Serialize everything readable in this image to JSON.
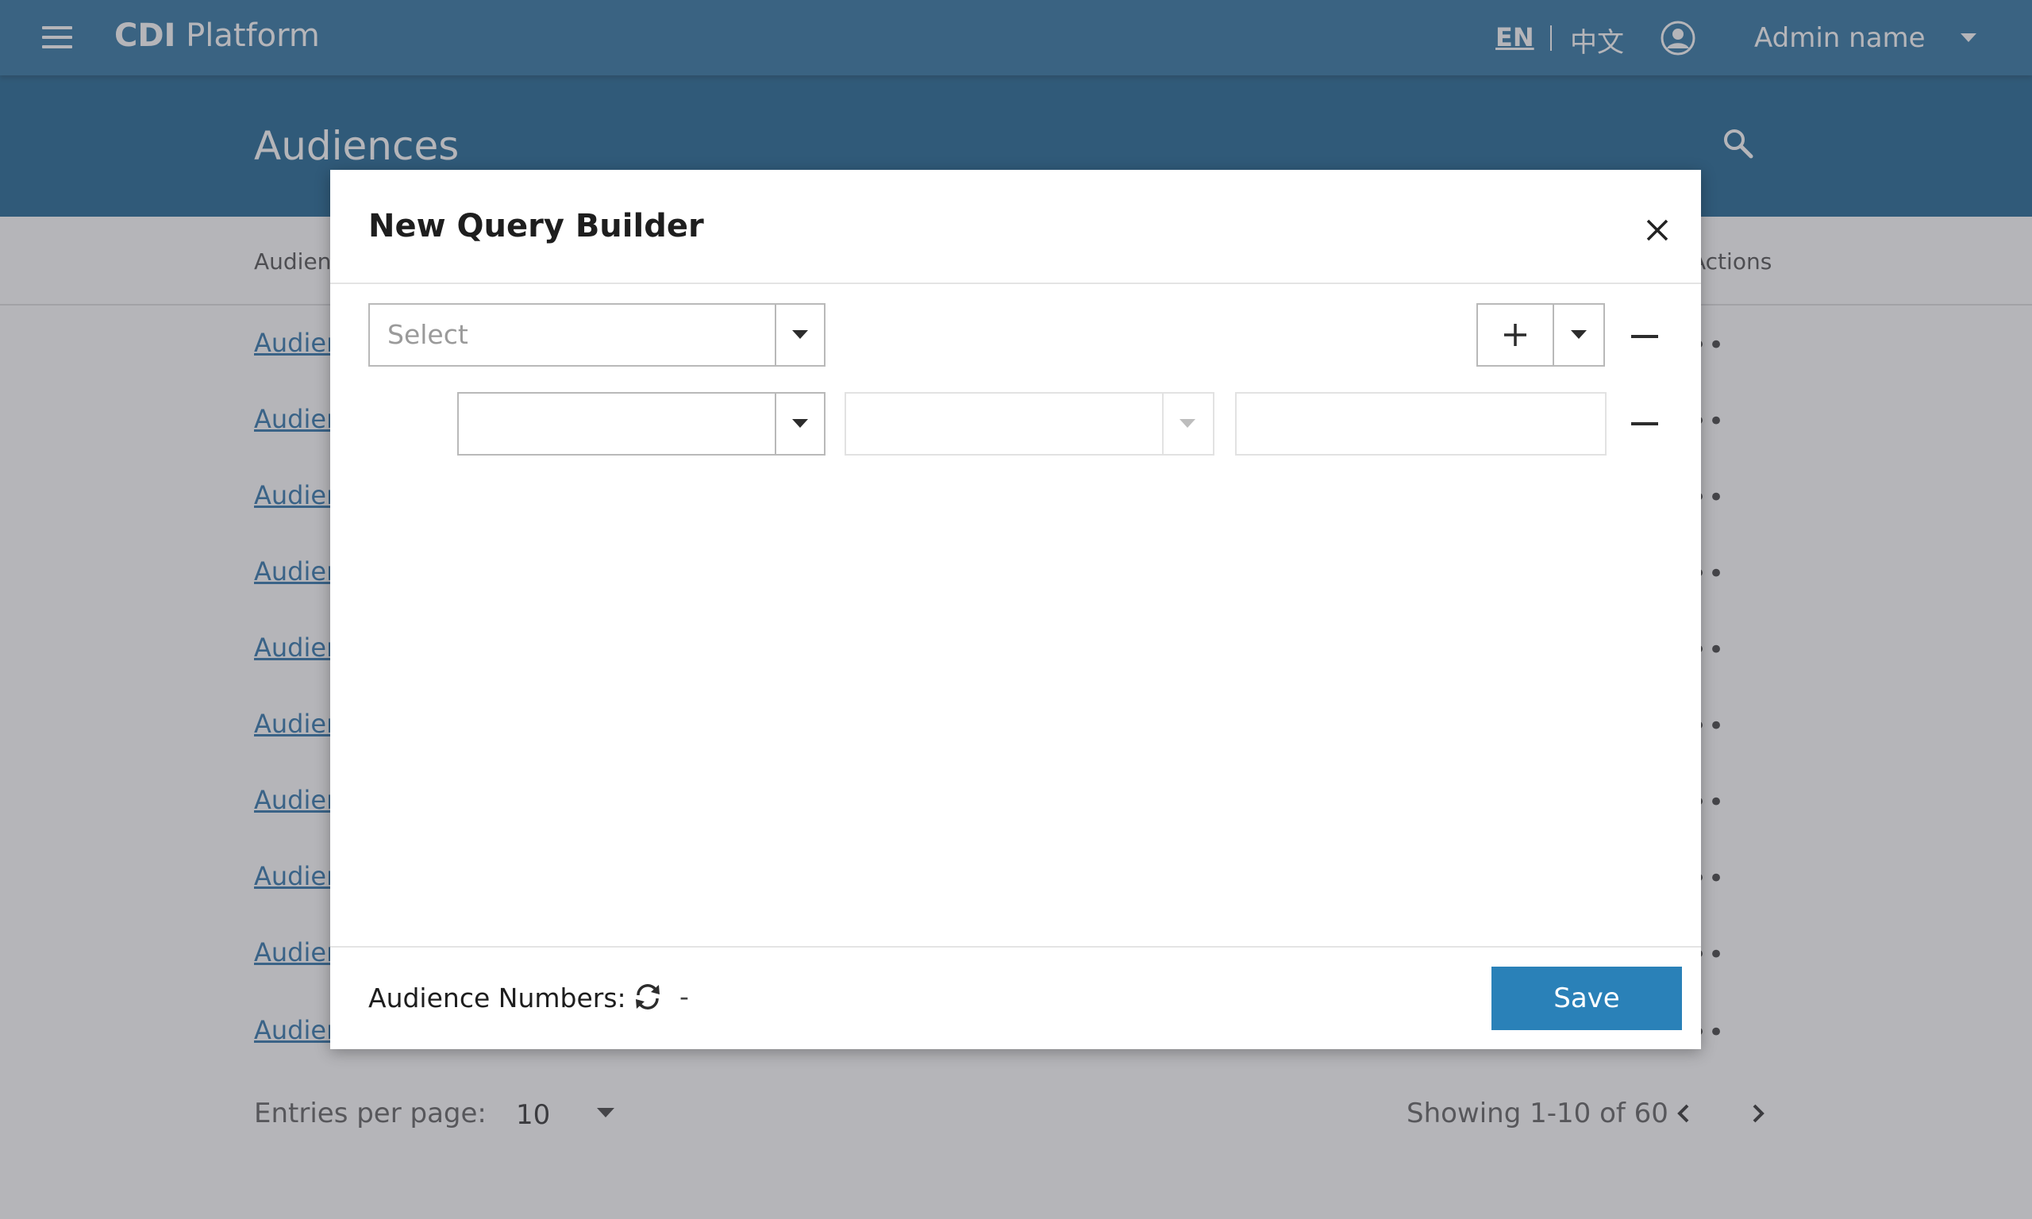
{
  "topbar": {
    "app_name_bold": "CDI",
    "app_name_rest": " Platform",
    "lang_en": "EN",
    "lang_zh": "中文",
    "admin_name": "Admin name"
  },
  "page": {
    "title": "Audiences"
  },
  "table": {
    "column_audience": "Audien",
    "column_actions": "Actions",
    "rows": [
      {
        "name": "Audien",
        "actions": "••"
      },
      {
        "name": "Audien",
        "actions": "••"
      },
      {
        "name": "Audien",
        "actions": "••"
      },
      {
        "name": "Audien",
        "actions": "••"
      },
      {
        "name": "Audien",
        "actions": "••"
      },
      {
        "name": "Audien",
        "actions": "••"
      },
      {
        "name": "Audien",
        "actions": "••"
      },
      {
        "name": "Audien",
        "actions": "••"
      },
      {
        "name": "Audien",
        "actions": "••"
      },
      {
        "name": "Audien",
        "actions": "••"
      }
    ]
  },
  "pagination": {
    "entries_label": "Entries per page:",
    "entries_value": "10",
    "showing": "Showing 1-10 of 60"
  },
  "modal": {
    "title": "New Query Builder",
    "group_select_placeholder": "Select",
    "field_select_value": "",
    "operator_select_value": "",
    "value_input": "",
    "audience_numbers_label": "Audience Numbers:",
    "audience_numbers_value": "-",
    "save_label": "Save"
  },
  "colors": {
    "topbar": "#1f6a9c",
    "page_header": "#0e5a8a",
    "accent": "#2a81b8",
    "link": "#1f6aa5"
  },
  "icons": [
    "menu-icon",
    "user-avatar-icon",
    "chevron-down-icon",
    "search-icon",
    "close-icon",
    "plus-icon",
    "minus-icon",
    "refresh-icon",
    "chevron-left-icon",
    "chevron-right-icon"
  ]
}
